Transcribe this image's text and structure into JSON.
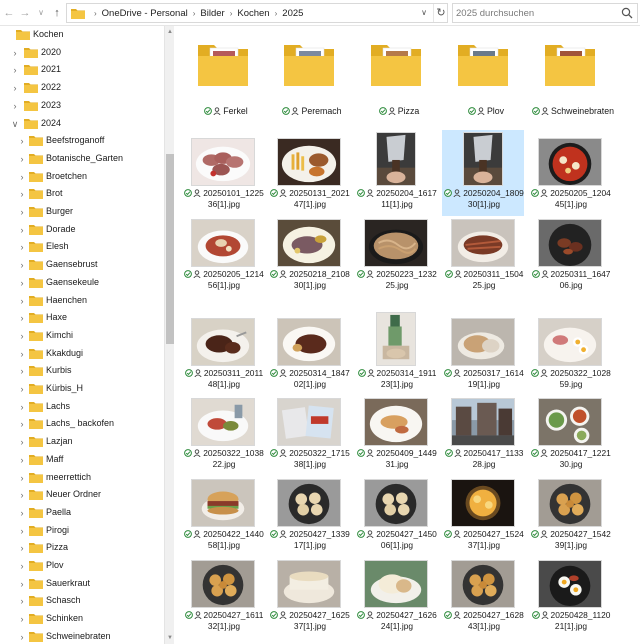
{
  "addressbar": {
    "path": [
      "OneDrive - Personal",
      "Bilder",
      "Kochen",
      "2025"
    ],
    "search_placeholder": "2025 durchsuchen"
  },
  "tree": {
    "root": "Kochen",
    "years": [
      "2020",
      "2021",
      "2022",
      "2023",
      "2024"
    ],
    "expanded_year": "2024",
    "subfolders": [
      "Beefstroganoff",
      "Botanische_Garten",
      "Broetchen",
      "Brot",
      "Burger",
      "Dorade",
      "Elesh",
      "Gaensebrust",
      "Gaensekeule",
      "Haenchen",
      "Haxe",
      "Kimchi",
      "Kkakdugi",
      "Kurbis",
      "Kürbis_H",
      "Lachs",
      "Lachs_ backofen",
      "Lazjan",
      "Maff",
      "meerrettich",
      "Neuer Ordner",
      "Paella",
      "Pirogi",
      "Pizza",
      "Plov",
      "Sauerkraut",
      "Schasch",
      "Schinken",
      "Schweinebraten"
    ]
  },
  "folders": [
    {
      "name": "Ferkel"
    },
    {
      "name": "Peremach"
    },
    {
      "name": "Pizza"
    },
    {
      "name": "Plov"
    },
    {
      "name": "Schweinebraten"
    }
  ],
  "files": [
    {
      "name": "20250101_122536[1].jpg",
      "kind": "sliced-sausage"
    },
    {
      "name": "20250131_202147[1].jpg",
      "kind": "fries-plate"
    },
    {
      "name": "20250204_161711[1].jpg",
      "kind": "knife",
      "portrait": true
    },
    {
      "name": "20250204_180930[1].jpg",
      "kind": "knife",
      "portrait": true,
      "selected": true
    },
    {
      "name": "20250205_120445[1].jpg",
      "kind": "pan-tomato"
    },
    {
      "name": "20250205_121456[1].jpg",
      "kind": "soup-bowl"
    },
    {
      "name": "20250218_210830[1].jpg",
      "kind": "plate-meat"
    },
    {
      "name": "20250223_123225.jpg",
      "kind": "noodles"
    },
    {
      "name": "20250311_150425.jpg",
      "kind": "steak"
    },
    {
      "name": "20250311_164706.jpg",
      "kind": "pan-dark"
    },
    {
      "name": "20250311_201148[1].jpg",
      "kind": "ribs"
    },
    {
      "name": "20250314_184702[1].jpg",
      "kind": "plate-steak"
    },
    {
      "name": "20250314_191123[1].jpg",
      "kind": "bottle",
      "portrait": true
    },
    {
      "name": "20250317_161419[1].jpg",
      "kind": "bread"
    },
    {
      "name": "20250322_102859.jpg",
      "kind": "eggs-ham"
    },
    {
      "name": "20250322_103822.jpg",
      "kind": "pickles-plate"
    },
    {
      "name": "20250322_171538[1].jpg",
      "kind": "packages"
    },
    {
      "name": "20250409_144931.jpg",
      "kind": "plate-fish"
    },
    {
      "name": "20250417_113328.jpg",
      "kind": "street"
    },
    {
      "name": "20250417_122130.jpg",
      "kind": "salad-bowls"
    },
    {
      "name": "20250422_144058[1].jpg",
      "kind": "burger"
    },
    {
      "name": "20250427_133917[1].jpg",
      "kind": "dough-pan"
    },
    {
      "name": "20250427_145006[1].jpg",
      "kind": "dough-pan"
    },
    {
      "name": "20250427_152437[1].jpg",
      "kind": "oven"
    },
    {
      "name": "20250427_154239[1].jpg",
      "kind": "buns-pan"
    },
    {
      "name": "20250427_161132[1].jpg",
      "kind": "buns-pan"
    },
    {
      "name": "20250427_162537[1].jpg",
      "kind": "cake"
    },
    {
      "name": "20250427_162624[1].jpg",
      "kind": "bread-torn"
    },
    {
      "name": "20250427_162843[1].jpg",
      "kind": "buns-pan"
    },
    {
      "name": "20250428_112021[1].jpg",
      "kind": "pan-eggs"
    }
  ],
  "colors": {
    "folder": "#f4c542",
    "folder_dark": "#e2ad23",
    "synced_green": "#2e8b3c",
    "selection": "#cce8ff"
  }
}
